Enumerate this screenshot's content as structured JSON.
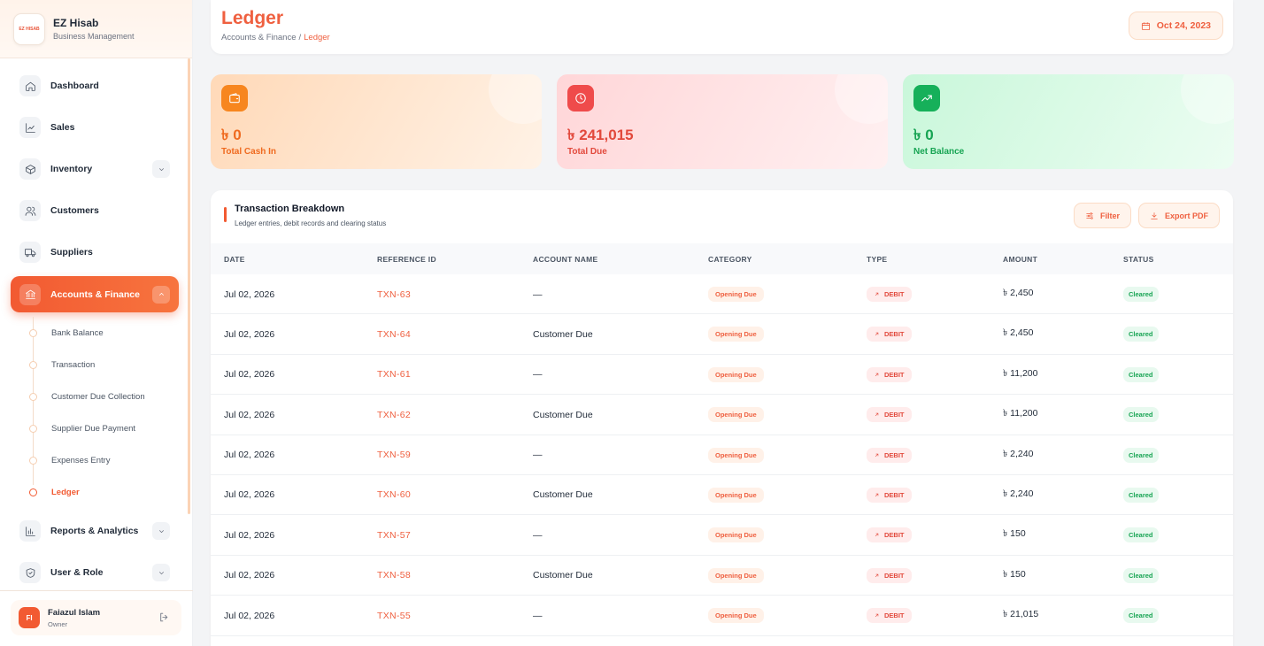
{
  "brand": {
    "logo_text": "EZ HISAB",
    "name": "EZ Hisab",
    "subtitle": "Business Management"
  },
  "sidebar": {
    "items": [
      {
        "label": "Dashboard",
        "icon": "home-icon"
      },
      {
        "label": "Sales",
        "icon": "chart-line-icon"
      },
      {
        "label": "Inventory",
        "icon": "box-icon",
        "has_chevron": true
      },
      {
        "label": "Customers",
        "icon": "users-icon"
      },
      {
        "label": "Suppliers",
        "icon": "truck-icon"
      },
      {
        "label": "Accounts & Finance",
        "icon": "bank-icon",
        "active": true,
        "expanded": true
      },
      {
        "label": "Reports & Analytics",
        "icon": "bar-chart-icon",
        "has_chevron": true
      },
      {
        "label": "User & Role",
        "icon": "shield-icon",
        "has_chevron": true
      }
    ],
    "sub_items": [
      {
        "label": "Bank Balance"
      },
      {
        "label": "Transaction"
      },
      {
        "label": "Customer Due Collection"
      },
      {
        "label": "Supplier Due Payment"
      },
      {
        "label": "Expenses Entry"
      },
      {
        "label": "Ledger",
        "active": true
      }
    ]
  },
  "user": {
    "initials": "FI",
    "name": "Faiazul Islam",
    "role": "Owner"
  },
  "header": {
    "title": "Ledger",
    "breadcrumb_parent": "Accounts & Finance",
    "breadcrumb_sep": "/",
    "breadcrumb_current": "Ledger",
    "date": "Oct 24, 2023"
  },
  "stats": [
    {
      "value": "৳ 0",
      "label": "Total Cash In",
      "icon": "wallet-icon"
    },
    {
      "value": "৳ 241,015",
      "label": "Total Due",
      "icon": "clock-icon"
    },
    {
      "value": "৳ 0",
      "label": "Net Balance",
      "icon": "trending-up-icon"
    }
  ],
  "table": {
    "title": "Transaction Breakdown",
    "subtitle": "Ledger entries, debit records and clearing status",
    "filter_label": "Filter",
    "export_label": "Export PDF",
    "columns": [
      "DATE",
      "REFERENCE ID",
      "ACCOUNT NAME",
      "CATEGORY",
      "TYPE",
      "AMOUNT",
      "STATUS"
    ],
    "rows": [
      {
        "date": "Jul 02, 2026",
        "ref": "TXN-63",
        "account": "—",
        "category": "Opening Due",
        "type": "DEBIT",
        "amount": "৳ 2,450",
        "status": "Cleared"
      },
      {
        "date": "Jul 02, 2026",
        "ref": "TXN-64",
        "account": "Customer Due",
        "category": "Opening Due",
        "type": "DEBIT",
        "amount": "৳ 2,450",
        "status": "Cleared"
      },
      {
        "date": "Jul 02, 2026",
        "ref": "TXN-61",
        "account": "—",
        "category": "Opening Due",
        "type": "DEBIT",
        "amount": "৳ 11,200",
        "status": "Cleared"
      },
      {
        "date": "Jul 02, 2026",
        "ref": "TXN-62",
        "account": "Customer Due",
        "category": "Opening Due",
        "type": "DEBIT",
        "amount": "৳ 11,200",
        "status": "Cleared"
      },
      {
        "date": "Jul 02, 2026",
        "ref": "TXN-59",
        "account": "—",
        "category": "Opening Due",
        "type": "DEBIT",
        "amount": "৳ 2,240",
        "status": "Cleared"
      },
      {
        "date": "Jul 02, 2026",
        "ref": "TXN-60",
        "account": "Customer Due",
        "category": "Opening Due",
        "type": "DEBIT",
        "amount": "৳ 2,240",
        "status": "Cleared"
      },
      {
        "date": "Jul 02, 2026",
        "ref": "TXN-57",
        "account": "—",
        "category": "Opening Due",
        "type": "DEBIT",
        "amount": "৳ 150",
        "status": "Cleared"
      },
      {
        "date": "Jul 02, 2026",
        "ref": "TXN-58",
        "account": "Customer Due",
        "category": "Opening Due",
        "type": "DEBIT",
        "amount": "৳ 150",
        "status": "Cleared"
      },
      {
        "date": "Jul 02, 2026",
        "ref": "TXN-55",
        "account": "—",
        "category": "Opening Due",
        "type": "DEBIT",
        "amount": "৳ 21,015",
        "status": "Cleared"
      }
    ]
  },
  "colors": {
    "accent": "#f25a32",
    "cash_in": "#f7861f",
    "due": "#ef4b4b",
    "net": "#16b05a"
  }
}
